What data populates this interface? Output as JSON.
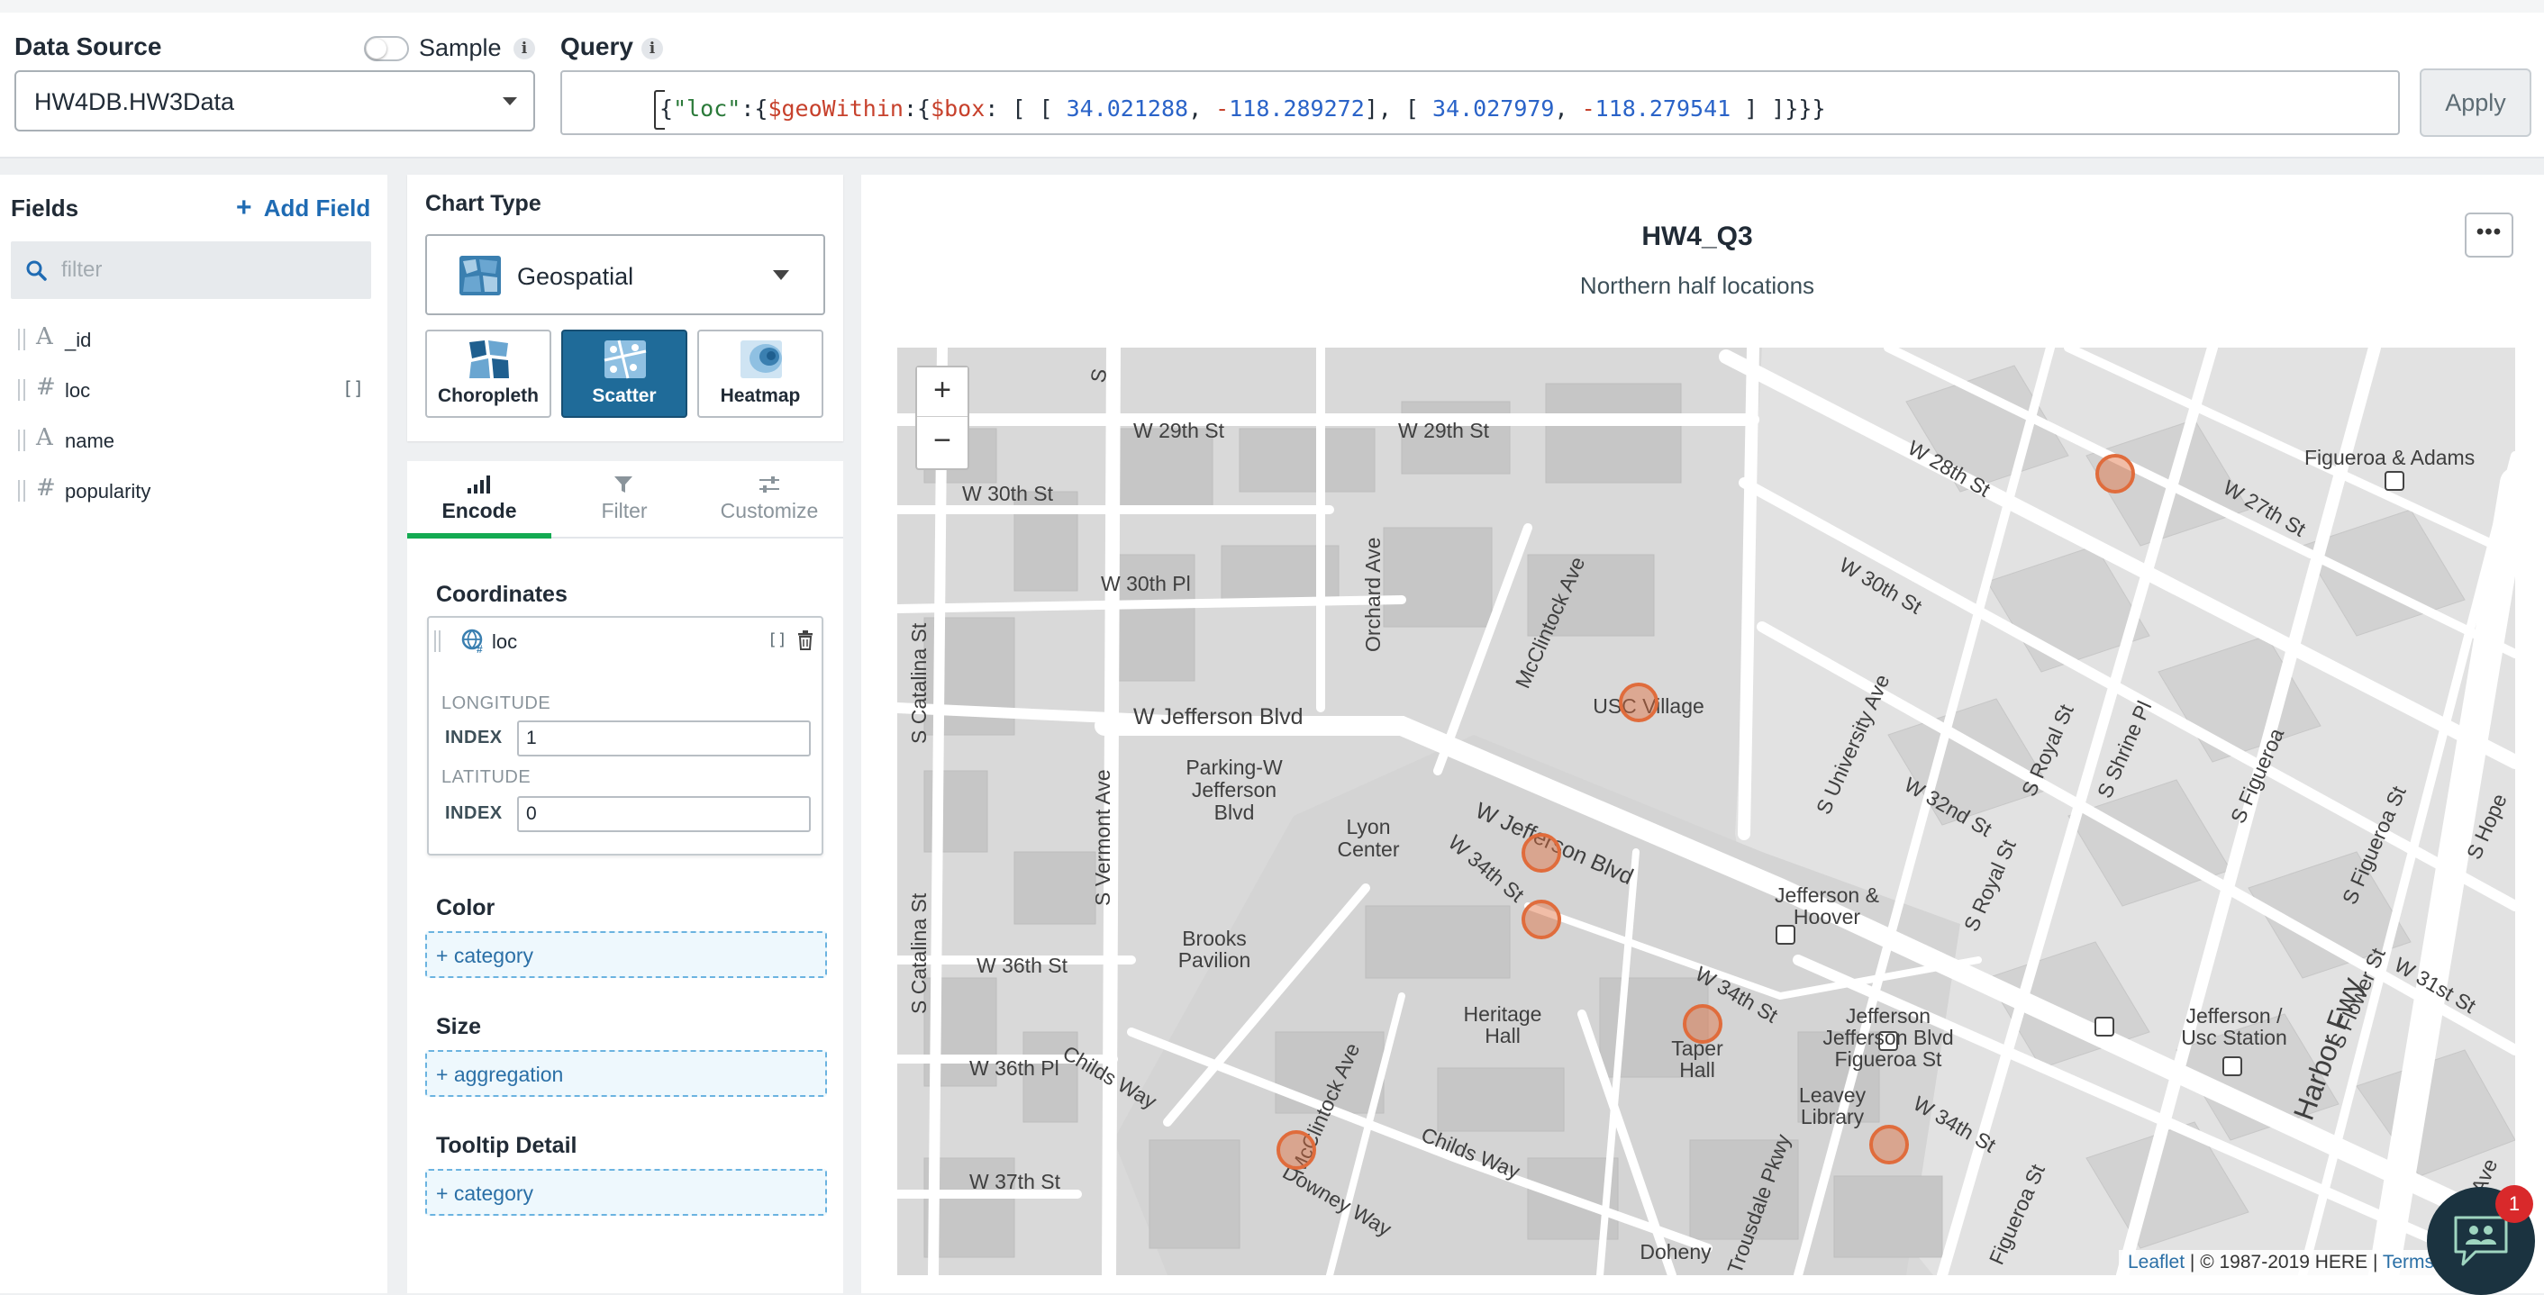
{
  "datasource": {
    "label": "Data Source",
    "value": "HW4DB.HW3Data",
    "sample_label": "Sample",
    "sample_on": false
  },
  "query": {
    "label": "Query",
    "parts": {
      "p1": "{",
      "p2": "\"loc\"",
      "p3": ":{",
      "p4": "$geoWithin",
      "p5": ":{",
      "p6": "$box",
      "p7": ": [ [ ",
      "p8": "34.021288",
      "p9": ", ",
      "p10": "-",
      "p11": "118.289272",
      "p12": "], [ ",
      "p13": "34.027979",
      "p14": ", ",
      "p15": "-",
      "p16": "118.279541",
      "p17": " ] ]}}}"
    },
    "apply_label": "Apply"
  },
  "fields": {
    "title": "Fields",
    "add_label": "Add Field",
    "filter_placeholder": "filter",
    "items": [
      {
        "type": "A",
        "name": "_id"
      },
      {
        "type": "#",
        "name": "loc"
      },
      {
        "type": "A",
        "name": "name"
      },
      {
        "type": "#",
        "name": "popularity"
      }
    ]
  },
  "chart_type": {
    "title": "Chart Type",
    "selected": "Geospatial",
    "subtypes": [
      "Choropleth",
      "Scatter",
      "Heatmap"
    ],
    "selected_subtype": "Scatter"
  },
  "encode": {
    "tabs": [
      "Encode",
      "Filter",
      "Customize"
    ],
    "active_tab": "Encode",
    "coordinates_title": "Coordinates",
    "coord_field": "loc",
    "longitude_label": "LONGITUDE",
    "latitude_label": "LATITUDE",
    "index_label": "INDEX",
    "longitude_index": "1",
    "latitude_index": "0",
    "color_title": "Color",
    "color_drop": "+ category",
    "size_title": "Size",
    "size_drop": "+ aggregation",
    "tooltip_title": "Tooltip Detail",
    "tooltip_drop": "+ category"
  },
  "chart": {
    "title": "HW4_Q3",
    "subtitle": "Northern half locations",
    "more_label": "•••",
    "zoom_in": "+",
    "zoom_out": "−",
    "marker_color": "#e06c3c",
    "attribution": {
      "leaflet": "Leaflet",
      "here": "| © 1987-2019 HERE |",
      "terms": "Terms"
    }
  },
  "map_labels": {
    "w29_a": "W 29th St",
    "w29_b": "W 29th St",
    "w30": "W 30th St",
    "w30pl": "W 30th Pl",
    "jeff": "W Jefferson Blvd",
    "jeff2": "W Jefferson Blvd",
    "parking": "Parking-W",
    "parking2": "Jefferson",
    "parking3": "Blvd",
    "lyon": "Lyon",
    "lyon2": "Center",
    "usc": "USC Village",
    "jh": "Jefferson &",
    "jh2": "Hoover",
    "brooks": "Brooks",
    "brooks2": "Pavilion",
    "w36": "W 36th St",
    "w36pl": "W 36th Pl",
    "w37": "W 37th St",
    "heritage": "Heritage",
    "heritage2": "Hall",
    "taper": "Taper",
    "taper2": "Hall",
    "leavey": "Leavey",
    "leavey2": "Library",
    "jf": "Jefferson Blvd",
    "jf_a": "Jefferson",
    "jf_c": "Figueroa St",
    "jusc": "Jefferson /",
    "jusc2": "Usc Station",
    "doheny": "Doheny",
    "harbor": "Harbor Fwy",
    "figadams": "Figueroa & Adams",
    "w28": "W 28th St",
    "w27": "W 27th St",
    "w30b": "W 30th St",
    "w32": "W 32nd St",
    "w34": "W 34th St",
    "w34b": "W 34th St",
    "w34c": "W 34th St",
    "w31": "W 31st St",
    "childs": "Childs Way",
    "childs2": "Childs Way",
    "mcc": "McClintock Ave",
    "mcc2": "McClintock Ave",
    "orchard": "Orchard Ave",
    "vermont": "S Vermont Ave",
    "catalina": "S Catalina St",
    "catalina2": "S Catalina St",
    "univ": "S University Ave",
    "royal": "S Royal St",
    "royal2": "S Royal St",
    "shrine": "S Shrine Pl",
    "fig": "S Figueroa",
    "fig2": "S Figueroa St",
    "fig3": "Figueroa St",
    "flower": "S Flower St",
    "hope": "S Hope",
    "grand": "S Grand Ave",
    "downey": "Downey Way",
    "trousdale": "Trousdale Pkwy",
    "s1": "S"
  }
}
